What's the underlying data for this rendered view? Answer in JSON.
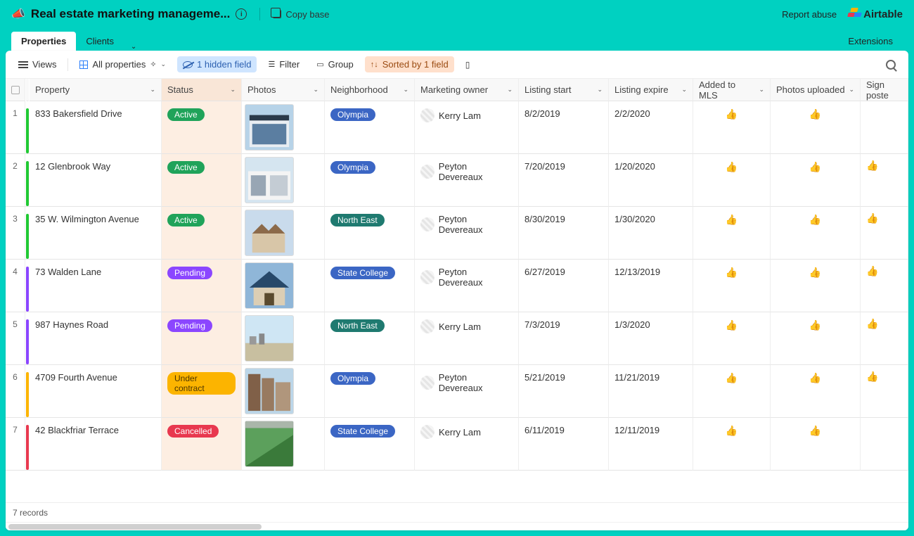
{
  "topbar": {
    "title": "Real estate marketing manageme...",
    "copy": "Copy base",
    "report": "Report abuse",
    "logo": "Airtable"
  },
  "tabs": {
    "properties": "Properties",
    "clients": "Clients",
    "extensions": "Extensions"
  },
  "toolbar": {
    "views": "Views",
    "all_props": "All properties",
    "hidden": "1 hidden field",
    "filter": "Filter",
    "group": "Group",
    "sorted": "Sorted by 1 field"
  },
  "headers": {
    "property": "Property",
    "status": "Status",
    "photos": "Photos",
    "neighborhood": "Neighborhood",
    "owner": "Marketing owner",
    "l_start": "Listing start",
    "l_expire": "Listing expire",
    "mls": "Added to MLS",
    "photos_up": "Photos uploaded",
    "sign": "Sign poste"
  },
  "rows": [
    {
      "n": "1",
      "bar": "bar-green",
      "property": "833 Bakersfield Drive",
      "status": "Active",
      "status_cls": "pill-green",
      "nbh": "Olympia",
      "nbh_cls": "pill-blueN",
      "owner": "Kerry Lam",
      "start": "8/2/2019",
      "expire": "2/2/2020",
      "mls": true,
      "pu": true,
      "sign": false
    },
    {
      "n": "2",
      "bar": "bar-green",
      "property": "12 Glenbrook Way",
      "status": "Active",
      "status_cls": "pill-green",
      "nbh": "Olympia",
      "nbh_cls": "pill-blueN",
      "owner": "Peyton Devereaux",
      "start": "7/20/2019",
      "expire": "1/20/2020",
      "mls": true,
      "pu": true,
      "sign": true
    },
    {
      "n": "3",
      "bar": "bar-green",
      "property": "35 W. Wilmington Avenue",
      "status": "Active",
      "status_cls": "pill-green",
      "nbh": "North East",
      "nbh_cls": "pill-tealN",
      "owner": "Peyton Devereaux",
      "start": "8/30/2019",
      "expire": "1/30/2020",
      "mls": true,
      "pu": true,
      "sign": true
    },
    {
      "n": "4",
      "bar": "bar-purple",
      "property": "73 Walden Lane",
      "status": "Pending",
      "status_cls": "pill-purple",
      "nbh": "State College",
      "nbh_cls": "pill-blueN",
      "owner": "Peyton Devereaux",
      "start": "6/27/2019",
      "expire": "12/13/2019",
      "mls": true,
      "pu": true,
      "sign": true
    },
    {
      "n": "5",
      "bar": "bar-purple",
      "property": "987 Haynes Road",
      "status": "Pending",
      "status_cls": "pill-purple",
      "nbh": "North East",
      "nbh_cls": "pill-tealN",
      "owner": "Kerry Lam",
      "start": "7/3/2019",
      "expire": "1/3/2020",
      "mls": true,
      "pu": true,
      "sign": true
    },
    {
      "n": "6",
      "bar": "bar-yellow",
      "property": "4709 Fourth Avenue",
      "status": "Under contract",
      "status_cls": "pill-yellow",
      "nbh": "Olympia",
      "nbh_cls": "pill-blueN",
      "owner": "Peyton Devereaux",
      "start": "5/21/2019",
      "expire": "11/21/2019",
      "mls": true,
      "pu": true,
      "sign": true
    },
    {
      "n": "7",
      "bar": "bar-red",
      "property": "42 Blackfriar Terrace",
      "status": "Cancelled",
      "status_cls": "pill-red",
      "nbh": "State College",
      "nbh_cls": "pill-blueN",
      "owner": "Kerry Lam",
      "start": "6/11/2019",
      "expire": "12/11/2019",
      "mls": true,
      "pu": true,
      "sign": false
    }
  ],
  "footer": {
    "records": "7 records"
  }
}
